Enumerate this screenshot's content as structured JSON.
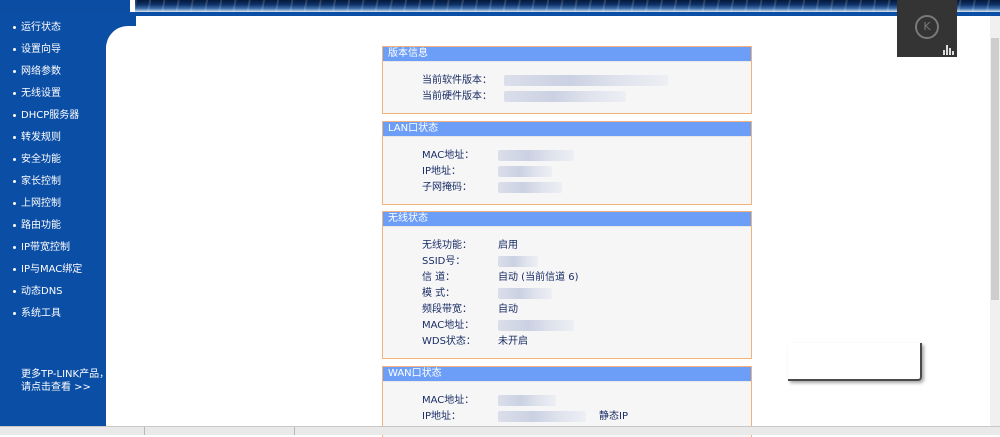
{
  "nav": {
    "items": [
      "运行状态",
      "设置向导",
      "网络参数",
      "无线设置",
      "DHCP服务器",
      "转发规则",
      "安全功能",
      "家长控制",
      "上网控制",
      "路由功能",
      "IP带宽控制",
      "IP与MAC绑定",
      "动态DNS",
      "系统工具"
    ],
    "more_line1": "更多TP-LINK产品，",
    "more_line2": "请点击查看 >>"
  },
  "version": {
    "title": "版本信息",
    "software_label": "当前软件版本：",
    "hardware_label": "当前硬件版本："
  },
  "lan": {
    "title": "LAN口状态",
    "mac_label": "MAC地址：",
    "ip_label": "IP地址：",
    "mask_label": "子网掩码："
  },
  "wireless": {
    "title": "无线状态",
    "function_label": "无线功能：",
    "function_value": "启用",
    "ssid_label": "SSID号：",
    "channel_label": "信 道：",
    "channel_value": "自动 (当前信道 6)",
    "mode_label": "模 式：",
    "bandwidth_label": "频段带宽：",
    "bandwidth_value": "自动",
    "mac_label": "MAC地址：",
    "wds_label": "WDS状态：",
    "wds_value": "未开启"
  },
  "wan": {
    "title": "WAN口状态",
    "mac_label": "MAC地址：",
    "ip_label": "IP地址：",
    "ip_type": "静态IP"
  },
  "colors": {
    "nav_bg": "#0b4ea6",
    "panel_header": "#6d9ef7",
    "panel_border": "#f2b37a",
    "text": "#1a2d66"
  },
  "icons": {
    "overlay_logo": "k-circle-icon",
    "overlay_chart": "bar-chart-icon",
    "nav_bullet": "dot-icon"
  }
}
